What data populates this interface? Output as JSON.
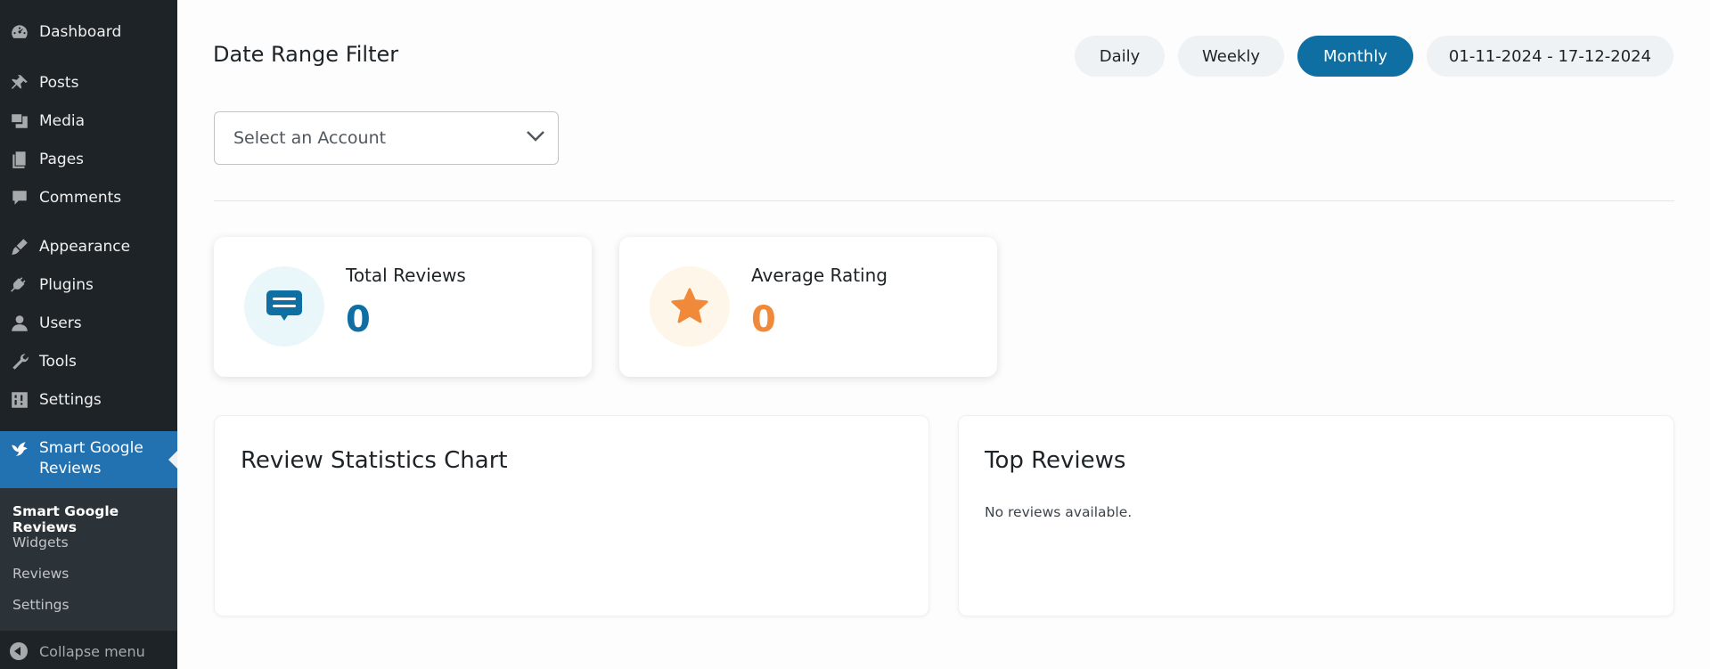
{
  "sidebar": {
    "items": [
      {
        "label": "Dashboard",
        "icon": "dashboard-icon"
      },
      {
        "label": "Posts",
        "icon": "pin-icon"
      },
      {
        "label": "Media",
        "icon": "media-icon"
      },
      {
        "label": "Pages",
        "icon": "pages-icon"
      },
      {
        "label": "Comments",
        "icon": "comment-icon"
      },
      {
        "label": "Appearance",
        "icon": "brush-icon"
      },
      {
        "label": "Plugins",
        "icon": "plug-icon"
      },
      {
        "label": "Users",
        "icon": "user-icon"
      },
      {
        "label": "Tools",
        "icon": "wrench-icon"
      },
      {
        "label": "Settings",
        "icon": "settings-icon"
      }
    ],
    "active_item": {
      "label_line1": "Smart Google",
      "label_line2": "Reviews",
      "icon": "bird-icon"
    },
    "submenu": [
      "Smart Google Reviews",
      "Widgets",
      "Reviews",
      "Settings"
    ],
    "collapse_label": "Collapse menu"
  },
  "header": {
    "title": "Date Range Filter",
    "filters": [
      "Daily",
      "Weekly",
      "Monthly"
    ],
    "active_filter": "Monthly",
    "date_range": "01-11-2024 - 17-12-2024"
  },
  "account_select": {
    "placeholder": "Select an Account"
  },
  "stats": {
    "total_reviews": {
      "label": "Total Reviews",
      "value": "0",
      "color": "#0f6fa2"
    },
    "average_rating": {
      "label": "Average Rating",
      "value": "0",
      "color": "#f08a3a"
    }
  },
  "panels": {
    "chart_title": "Review Statistics Chart",
    "top_reviews_title": "Top Reviews",
    "top_reviews_empty": "No reviews available."
  },
  "colors": {
    "sidebar_bg": "#1d2327",
    "accent": "#2271b1",
    "primary": "#0f6fa2",
    "orange": "#f08a3a"
  }
}
